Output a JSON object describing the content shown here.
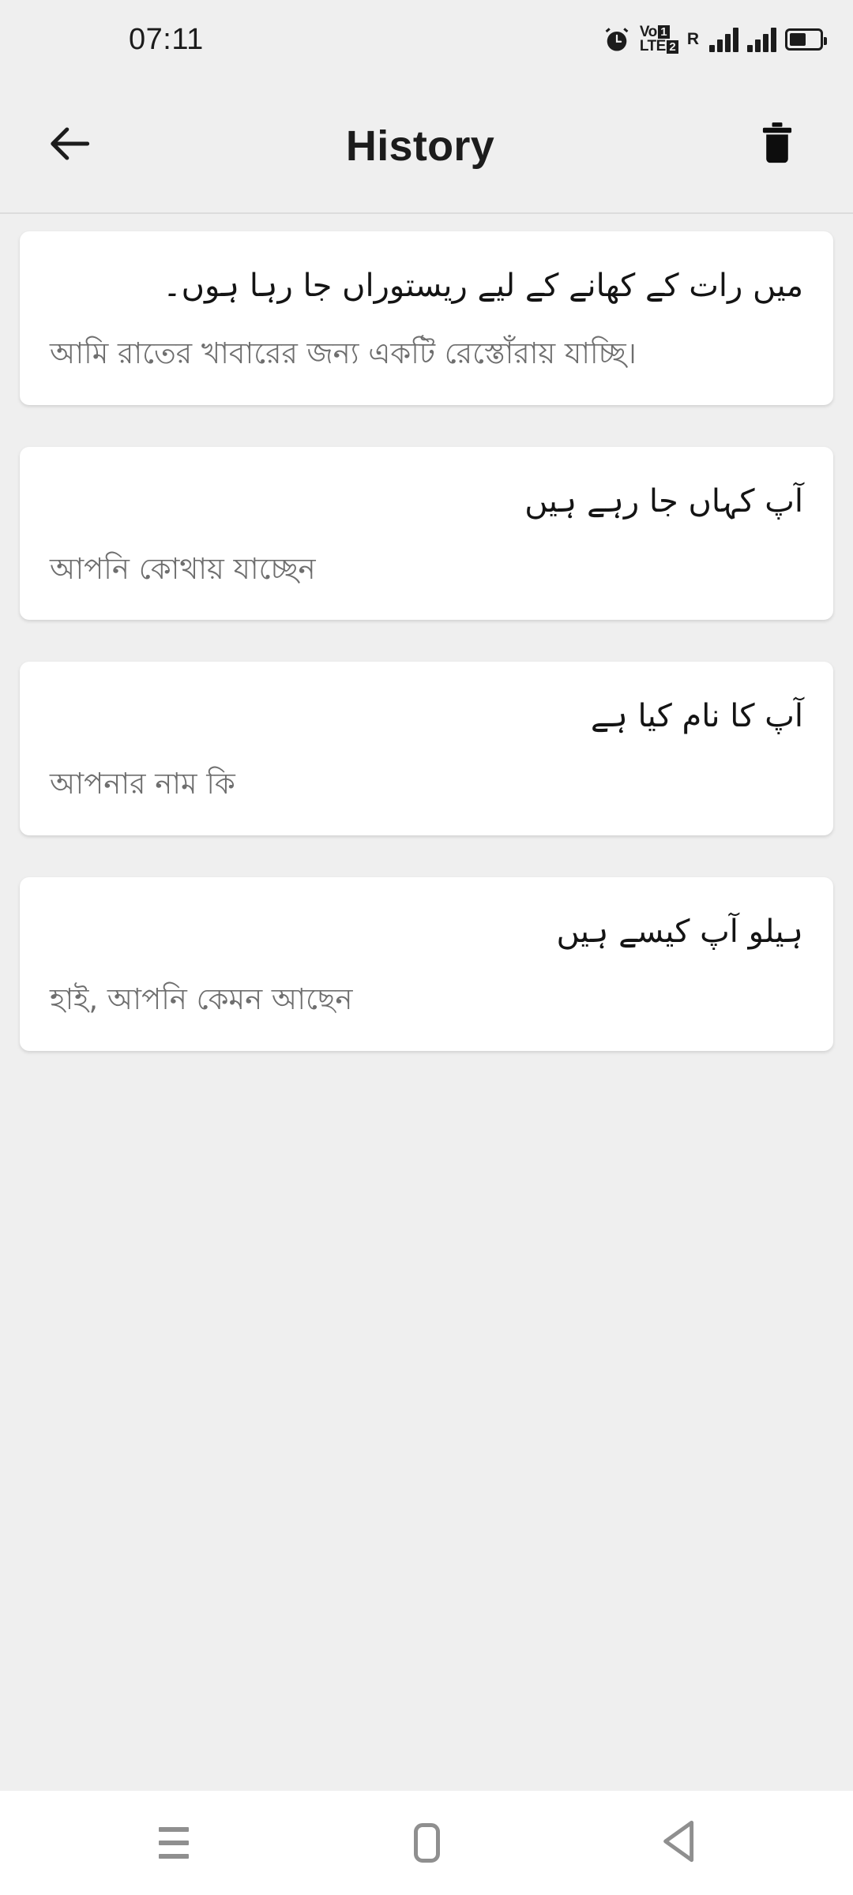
{
  "status_bar": {
    "time": "07:11",
    "icons": [
      {
        "name": "alarm-clock-icon"
      },
      {
        "name": "volte-dual-sim-icon",
        "line1": "Vo",
        "line1_badge": "1",
        "line2": "LTE",
        "line2_badge": "2"
      },
      {
        "name": "roaming-indicator",
        "label": "R"
      },
      {
        "name": "signal-bars-sim1-icon"
      },
      {
        "name": "signal-bars-sim2-icon"
      },
      {
        "name": "battery-icon",
        "level_percent": 55
      }
    ]
  },
  "app_bar": {
    "back_icon": "arrow-left-icon",
    "title": "History",
    "delete_icon": "trash-icon"
  },
  "history": {
    "items": [
      {
        "source_text": "میں رات کے کھانے کے لیے ریستوراں جا رہا ہوں۔",
        "target_text": "আমি রাতের খাবারের জন্য একটি রেস্তোঁরায় যাচ্ছি।"
      },
      {
        "source_text": "آپ کہاں جا رہے ہیں",
        "target_text": "আপনি কোথায় যাচ্ছেন"
      },
      {
        "source_text": "آپ کا نام کیا ہے",
        "target_text": "আপনার নাম কি"
      },
      {
        "source_text": "ہیلو آپ کیسے ہیں",
        "target_text": "হাই, আপনি কেমন আছেন"
      }
    ]
  },
  "nav_bar": {
    "recents_icon": "menu-icon",
    "home_icon": "home-square-icon",
    "back_icon": "back-triangle-icon"
  },
  "colors": {
    "background": "#efefef",
    "card": "#ffffff",
    "source_text": "#141414",
    "target_text": "#6e6e6e",
    "nav_icon": "#8f8f8f",
    "divider": "#dcdcdc"
  }
}
